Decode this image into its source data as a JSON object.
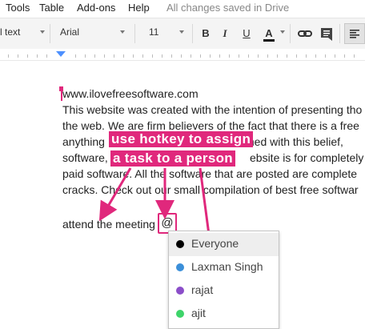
{
  "menu": {
    "items": [
      "Tools",
      "Table",
      "Add-ons",
      "Help"
    ],
    "save_status": "All changes saved in Drive"
  },
  "toolbar": {
    "style_value": "l text",
    "font_value": "Arial",
    "size_value": "11",
    "bold_label": "B",
    "italic_label": "I",
    "underline_label": "U",
    "text_color_label": "A"
  },
  "document": {
    "lines": [
      "www.ilovefreesoftware.com",
      "This website was created with the intention of presenting tho",
      "the web. We are firm believers of the fact that there is a free",
      "anything",
      "software,",
      "paid software. All the software that are posted are complete",
      "cracks. Check out our small compilation of best free softwar"
    ],
    "line3_tail": "med with this belief,",
    "line4_tail": "ebsite is for completely",
    "attend_text": "attend the meeting",
    "at_symbol": "@"
  },
  "annotation": {
    "line1": "use hotkey to assign",
    "line2": "a task to a person",
    "color": "#e0287c"
  },
  "mention_popup": {
    "items": [
      {
        "name": "Everyone",
        "color": "#000000"
      },
      {
        "name": "Laxman Singh",
        "color": "#3b8fd9"
      },
      {
        "name": "rajat",
        "color": "#8b4ec9"
      },
      {
        "name": "ajit",
        "color": "#3ed46a"
      }
    ]
  }
}
